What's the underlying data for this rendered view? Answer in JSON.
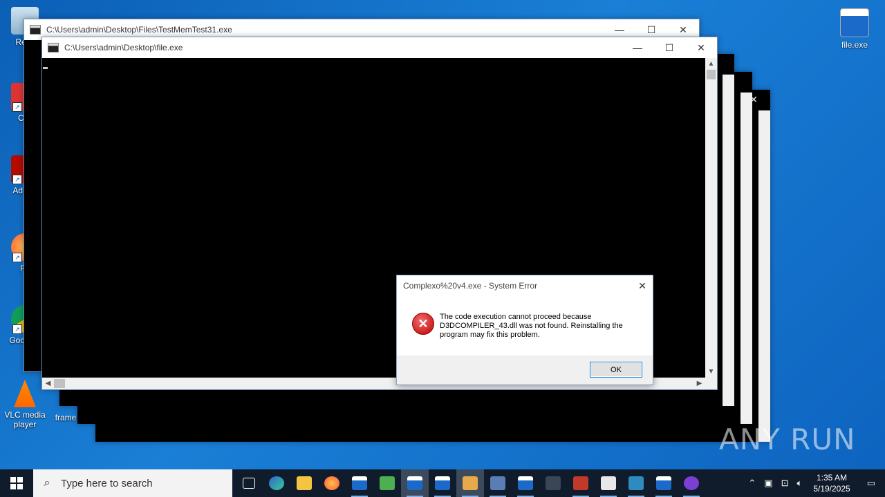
{
  "desktop": {
    "icons": [
      {
        "label": "Recy",
        "name": "recycle-bin-icon"
      },
      {
        "label": "CCl",
        "name": "ccleaner-icon"
      },
      {
        "label": "Ad Acr",
        "name": "acrobat-icon"
      },
      {
        "label": "Fir",
        "name": "firefox-icon"
      },
      {
        "label": "Goo Chr",
        "name": "chrome-icon"
      },
      {
        "label": "VLC media player",
        "name": "vlc-icon"
      },
      {
        "label": "frame",
        "name": "frame-icon"
      },
      {
        "label": "file.exe",
        "name": "file-exe-icon"
      }
    ]
  },
  "windows": {
    "back": {
      "title": "C:\\Users\\admin\\Desktop\\Files\\TestMemTest31.exe"
    },
    "front": {
      "title": "C:\\Users\\admin\\Desktop\\file.exe"
    }
  },
  "dialog": {
    "title": "Complexo%20v4.exe - System Error",
    "message": "The code execution cannot proceed because D3DCOMPILER_43.dll was not found. Reinstalling the program may fix this problem.",
    "ok_label": "OK"
  },
  "taskbar": {
    "search_placeholder": "Type here to search",
    "time": "1:35 AM",
    "date": "5/19/2025"
  },
  "watermark": "ANY RUN"
}
